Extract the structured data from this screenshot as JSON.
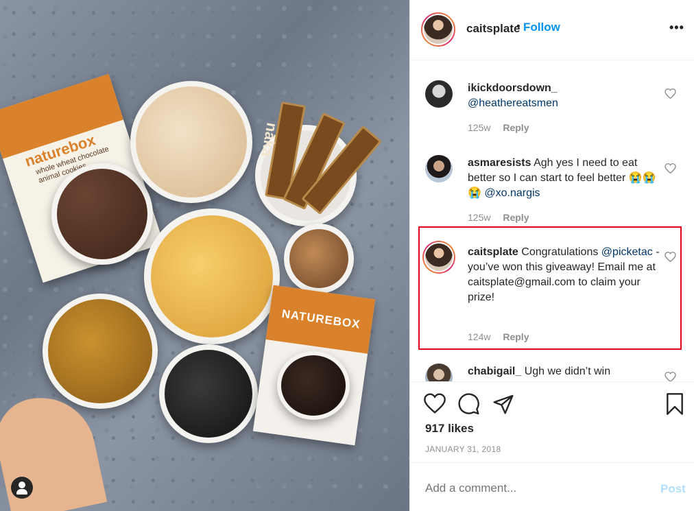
{
  "post": {
    "author": "caitsplate",
    "follow_separator": "•",
    "follow_label": "Follow",
    "more_label": "•••",
    "likes": "917 likes",
    "date": "JANUARY 31, 2018"
  },
  "photo": {
    "naturebox_bag_label": "naturebox",
    "naturebox_bag_sub": "whole wheat chocolate animal cookies",
    "naka_bar_label": "nāka",
    "naturebox_bag2_label": "NATUREBOX"
  },
  "comments": [
    {
      "user": "ikickdoorsdown_",
      "text": "",
      "mention": "@heathereatsmen",
      "age": "125w",
      "reply": "Reply"
    },
    {
      "user": "asmaresists",
      "text": "Agh yes I need to eat better so I can start to feel better 😭😭😭",
      "mention": "@xo.nargis",
      "age": "125w",
      "reply": "Reply"
    },
    {
      "user": "caitsplate",
      "text_pre": "Congratulations",
      "mention": "@picketac",
      "text_post": "- you’ve won this giveaway! Email me at caitsplate@gmail.com to claim your prize!",
      "age": "124w",
      "reply": "Reply"
    },
    {
      "user": "chabigail_",
      "text": "Ugh we didn’t win"
    }
  ],
  "comment_box": {
    "placeholder": "Add a comment...",
    "post_label": "Post"
  },
  "colors": {
    "accent": "#0095f6",
    "highlight": "#e0001b"
  }
}
